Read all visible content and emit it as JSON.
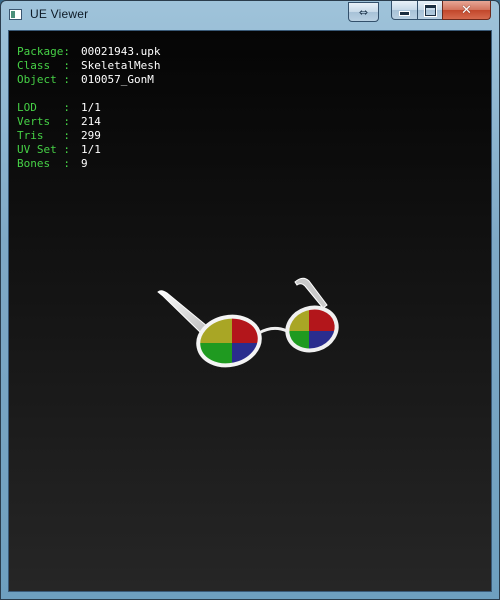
{
  "window": {
    "title": "UE Viewer"
  },
  "titlebar_buttons": {
    "swap": "⇔",
    "close": "✕"
  },
  "info": {
    "object_rows": [
      {
        "key": "Package:",
        "value": "00021943.upk"
      },
      {
        "key": "Class  :",
        "value": "SkeletalMesh"
      },
      {
        "key": "Object :",
        "value": "010057_GonM"
      }
    ],
    "mesh_rows": [
      {
        "key": "LOD    :",
        "value": "1/1"
      },
      {
        "key": "Verts  :",
        "value": "214"
      },
      {
        "key": "Tris   :",
        "value": "299"
      },
      {
        "key": "UV Set :",
        "value": "1/1"
      },
      {
        "key": "Bones  :",
        "value": "9"
      }
    ]
  },
  "colors": {
    "key_text": "#46d146",
    "value_text": "#ffffff",
    "lens_red": "#b3161b",
    "lens_yellow": "#a9a625",
    "lens_green": "#1f9a20",
    "lens_blue": "#2a2d8e"
  },
  "icons": {
    "app": "app-icon",
    "minimize": "minimize-icon",
    "maximize": "maximize-icon",
    "close": "close-icon",
    "swap": "swap-arrows-icon"
  }
}
